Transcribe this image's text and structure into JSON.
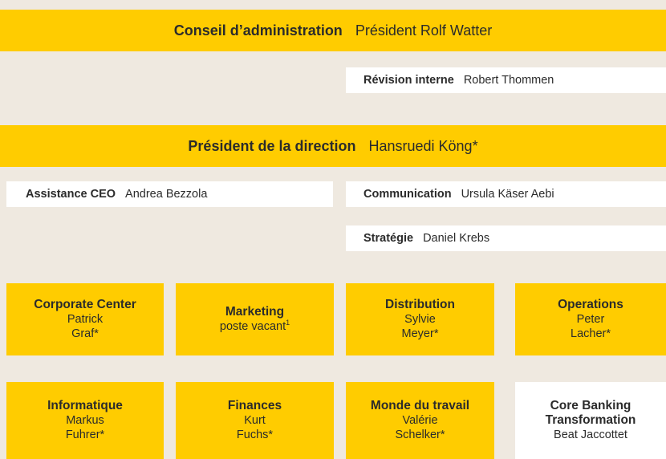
{
  "board": {
    "title": "Conseil d’administration",
    "person": "Président Rolf Watter"
  },
  "audit": {
    "title": "Révision interne",
    "person": "Robert Thommen"
  },
  "ceo": {
    "title": "Président de la direction",
    "person": "Hansruedi Köng*"
  },
  "staff": {
    "assistance": {
      "title": "Assistance CEO",
      "person": "Andrea Bezzola"
    },
    "communication": {
      "title": "Communication",
      "person": "Ursula Käser Aebi"
    },
    "strategy": {
      "title": "Stratégie",
      "person": "Daniel Krebs"
    }
  },
  "units": [
    {
      "title": "Corporate Center",
      "line1": "Patrick",
      "line2": "Graf*"
    },
    {
      "title": "Marketing",
      "line1": "poste vacant",
      "sup": "1"
    },
    {
      "title": "Distribution",
      "line1": "Sylvie",
      "line2": "Meyer*"
    },
    {
      "title": "Operations",
      "line1": "Peter",
      "line2": "Lacher*"
    },
    {
      "title": "Informatique",
      "line1": "Markus",
      "line2": "Fuhrer*"
    },
    {
      "title": "Finances",
      "line1": "Kurt",
      "line2": "Fuchs*"
    },
    {
      "title": "Monde du travail",
      "line1": "Valérie",
      "line2": "Schelker*"
    },
    {
      "title": "Core Banking",
      "title2": "Transformation",
      "line1": "Beat Jaccottet"
    }
  ],
  "colors": {
    "accent": "#ffcc00",
    "background": "#efe9e0",
    "box_white": "#ffffff"
  }
}
